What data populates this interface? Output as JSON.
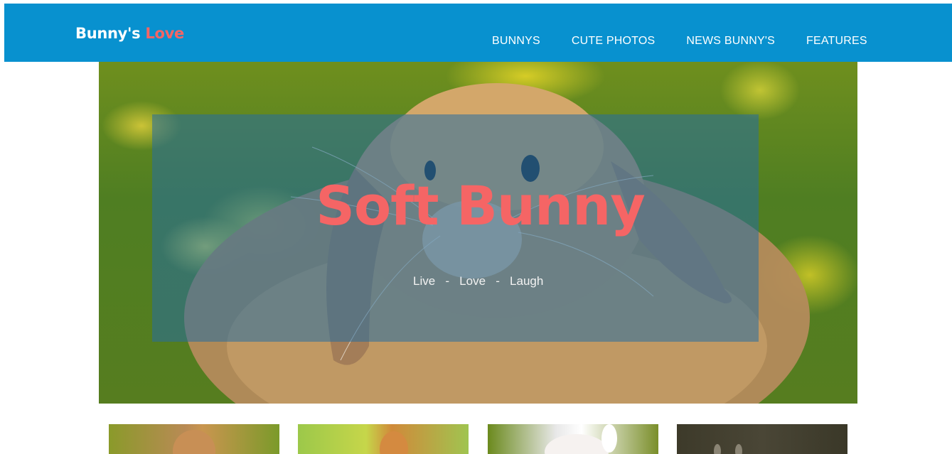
{
  "brand": {
    "name": "Bunny's",
    "accent": "Love"
  },
  "nav": {
    "items": [
      {
        "label": "BUNNYS"
      },
      {
        "label": "CUTE PHOTOS"
      },
      {
        "label": "NEWS BUNNY'S"
      },
      {
        "label": "FEATURES"
      }
    ]
  },
  "hero": {
    "title": "Soft Bunny",
    "tagline": "Live   -   Love   -   Laugh"
  },
  "colors": {
    "navbar": "#0891cf",
    "accent": "#f56565",
    "overlay": "#266ea0"
  }
}
